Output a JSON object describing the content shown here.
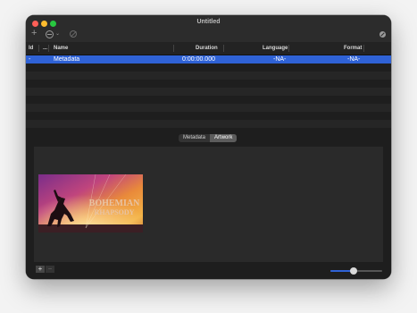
{
  "window": {
    "title": "Untitled"
  },
  "table": {
    "columns": [
      {
        "label": "Id"
      },
      {
        "label": "..."
      },
      {
        "label": "Name"
      },
      {
        "label": "Duration"
      },
      {
        "label": "Language"
      },
      {
        "label": "Format"
      }
    ],
    "rows": [
      {
        "id": "-",
        "name": "Metadata",
        "duration": "0:00:00.000",
        "language": "-NA-",
        "format": "-NA-",
        "selected": true
      }
    ]
  },
  "tabs": [
    {
      "label": "Metadata",
      "active": false
    },
    {
      "label": "Artwork",
      "active": true
    }
  ],
  "artwork": {
    "title_line1": "BOHEMIAN",
    "title_line2": "RHAPSODY"
  },
  "bottom": {
    "add_label": "+",
    "remove_label": "−",
    "zoom_level": 0.45
  },
  "colors": {
    "selection": "#2f62d6",
    "window_bg": "#1e1e1e"
  },
  "icons": [
    "plus-icon",
    "action-menu-icon",
    "remove-icon",
    "info-icon"
  ]
}
